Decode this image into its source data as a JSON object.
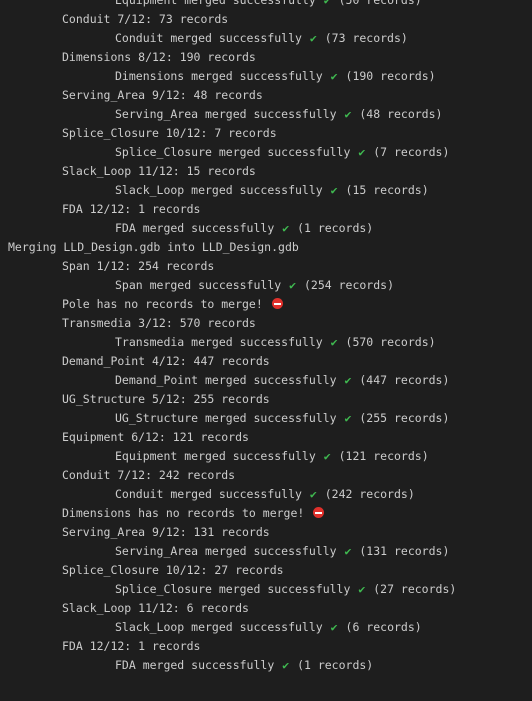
{
  "lines": [
    {
      "indent": 2,
      "text": "Equipment merged successfully",
      "mark": "check",
      "after": "(50 records)"
    },
    {
      "indent": 1,
      "text": "Conduit 7/12: 73 records"
    },
    {
      "indent": 2,
      "text": "Conduit merged successfully",
      "mark": "check",
      "after": "(73 records)"
    },
    {
      "indent": 1,
      "text": "Dimensions 8/12: 190 records"
    },
    {
      "indent": 2,
      "text": "Dimensions merged successfully",
      "mark": "check",
      "after": "(190 records)"
    },
    {
      "indent": 1,
      "text": "Serving_Area 9/12: 48 records"
    },
    {
      "indent": 2,
      "text": "Serving_Area merged successfully",
      "mark": "check",
      "after": "(48 records)"
    },
    {
      "indent": 1,
      "text": "Splice_Closure 10/12: 7 records"
    },
    {
      "indent": 2,
      "text": "Splice_Closure merged successfully",
      "mark": "check",
      "after": "(7 records)"
    },
    {
      "indent": 1,
      "text": "Slack_Loop 11/12: 15 records"
    },
    {
      "indent": 2,
      "text": "Slack_Loop merged successfully",
      "mark": "check",
      "after": "(15 records)"
    },
    {
      "indent": 1,
      "text": "FDA 12/12: 1 records"
    },
    {
      "indent": 2,
      "text": "FDA merged successfully",
      "mark": "check",
      "after": "(1 records)"
    },
    {
      "indent": 0,
      "text": "Merging LLD_Design.gdb into LLD_Design.gdb"
    },
    {
      "indent": 1,
      "text": "Span 1/12: 254 records"
    },
    {
      "indent": 2,
      "text": "Span merged successfully",
      "mark": "check",
      "after": "(254 records)"
    },
    {
      "indent": 1,
      "text": "Pole has no records to merge!",
      "mark": "stop"
    },
    {
      "indent": 1,
      "text": "Transmedia 3/12: 570 records"
    },
    {
      "indent": 2,
      "text": "Transmedia merged successfully",
      "mark": "check",
      "after": "(570 records)"
    },
    {
      "indent": 1,
      "text": "Demand_Point 4/12: 447 records"
    },
    {
      "indent": 2,
      "text": "Demand_Point merged successfully",
      "mark": "check",
      "after": "(447 records)"
    },
    {
      "indent": 1,
      "text": "UG_Structure 5/12: 255 records"
    },
    {
      "indent": 2,
      "text": "UG_Structure merged successfully",
      "mark": "check",
      "after": "(255 records)"
    },
    {
      "indent": 1,
      "text": "Equipment 6/12: 121 records"
    },
    {
      "indent": 2,
      "text": "Equipment merged successfully",
      "mark": "check",
      "after": "(121 records)"
    },
    {
      "indent": 1,
      "text": "Conduit 7/12: 242 records"
    },
    {
      "indent": 2,
      "text": "Conduit merged successfully",
      "mark": "check",
      "after": "(242 records)"
    },
    {
      "indent": 1,
      "text": "Dimensions has no records to merge!",
      "mark": "stop"
    },
    {
      "indent": 1,
      "text": "Serving_Area 9/12: 131 records"
    },
    {
      "indent": 2,
      "text": "Serving_Area merged successfully",
      "mark": "check",
      "after": "(131 records)"
    },
    {
      "indent": 1,
      "text": "Splice_Closure 10/12: 27 records"
    },
    {
      "indent": 2,
      "text": "Splice_Closure merged successfully",
      "mark": "check",
      "after": "(27 records)"
    },
    {
      "indent": 1,
      "text": "Slack_Loop 11/12: 6 records"
    },
    {
      "indent": 2,
      "text": "Slack_Loop merged successfully",
      "mark": "check",
      "after": "(6 records)"
    },
    {
      "indent": 1,
      "text": "FDA 12/12: 1 records"
    },
    {
      "indent": 2,
      "text": "FDA merged successfully",
      "mark": "check",
      "after": "(1 records)"
    }
  ],
  "icons": {
    "check": "check-mark-icon",
    "stop": "no-entry-icon"
  },
  "colors": {
    "background": "#1e1e1e",
    "text": "#cccccc",
    "check": "#3fb950",
    "stop": "#e0302b"
  }
}
